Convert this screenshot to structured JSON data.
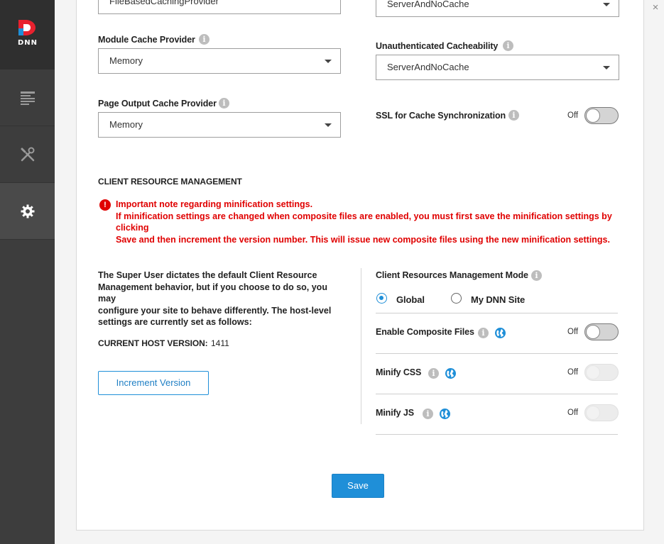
{
  "window": {
    "close_glyph": "×"
  },
  "sidebar": {
    "logo_text": "DNN",
    "items": [
      {
        "name": "content-icon"
      },
      {
        "name": "tools-icon"
      },
      {
        "name": "settings-icon",
        "active": true
      }
    ]
  },
  "cache": {
    "top_left_select_value": "FileBasedCachingProvider",
    "top_right_select_value": "ServerAndNoCache",
    "module_cache_provider": {
      "label": "Module Cache Provider",
      "value": "Memory"
    },
    "page_output_cache_provider": {
      "label": "Page Output Cache Provider",
      "value": "Memory"
    },
    "unauthenticated_cacheability": {
      "label": "Unauthenticated Cacheability",
      "value": "ServerAndNoCache"
    },
    "ssl_cache_sync": {
      "label": "SSL for Cache Synchronization",
      "state": "Off"
    }
  },
  "crm": {
    "heading": "CLIENT RESOURCE MANAGEMENT",
    "warning_title": "Important note regarding minification settings.",
    "warning_line1": "If minification settings are changed when composite files are enabled, you must first save the minification settings by clicking",
    "warning_line2": "Save and then increment the version number. This will issue new composite files using the new minification settings.",
    "description_lines": [
      "The Super User dictates the default Client Resource",
      "Management behavior, but if you choose to do so, you may",
      "configure your site to behave differently. The host-level",
      "settings are currently set as follows:"
    ],
    "host_version_label": "CURRENT HOST VERSION:",
    "host_version_value": "1411",
    "increment_button": "Increment Version",
    "mode_label": "Client Resources Management Mode",
    "mode_options": [
      "Global",
      "My DNN Site"
    ],
    "mode_selected": "Global",
    "enable_composite_files": {
      "label": "Enable Composite Files",
      "state": "Off"
    },
    "minify_css": {
      "label": "Minify CSS",
      "state": "Off"
    },
    "minify_js": {
      "label": "Minify JS",
      "state": "Off"
    }
  },
  "footer": {
    "save_button": "Save"
  },
  "colors": {
    "accent": "#1f8fd8",
    "warning": "#e00000",
    "sidebar": "#3d3d3d"
  }
}
